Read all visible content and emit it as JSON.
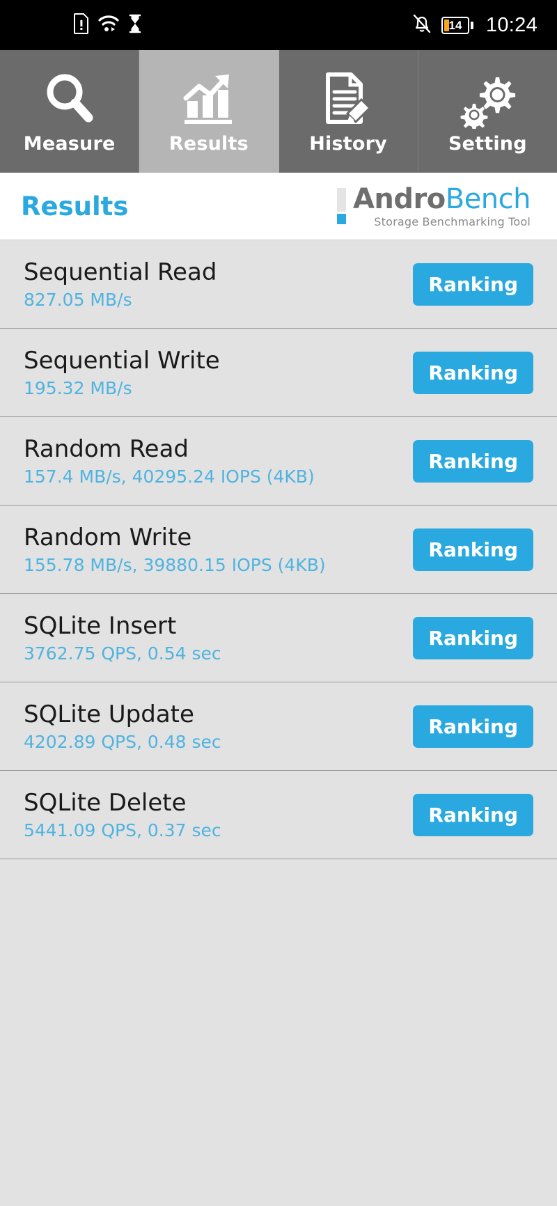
{
  "statusbar": {
    "time": "10:24",
    "battery_percent": "14",
    "icons_left": [
      "sim-alert-icon",
      "wifi-icon",
      "hourglass-icon"
    ],
    "icons_right": [
      "mute-bell-icon",
      "battery-icon"
    ]
  },
  "tabs": [
    {
      "label": "Measure",
      "icon": "search-icon",
      "active": false
    },
    {
      "label": "Results",
      "icon": "bar-chart-icon",
      "active": true
    },
    {
      "label": "History",
      "icon": "document-edit-icon",
      "active": false
    },
    {
      "label": "Setting",
      "icon": "gears-icon",
      "active": false
    }
  ],
  "header": {
    "title": "Results",
    "logo_primary": "Andro",
    "logo_secondary": "Bench",
    "logo_tagline": "Storage Benchmarking Tool"
  },
  "colors": {
    "accent_blue": "#29a9e0",
    "value_blue": "#4fb3e0",
    "tab_bg": "#6b6b6b",
    "tab_active_bg": "#b5b5b5",
    "list_bg": "#e2e2e2",
    "battery_orange": "#f5a623"
  },
  "results": {
    "button_label": "Ranking",
    "rows": [
      {
        "title": "Sequential Read",
        "value": "827.05 MB/s"
      },
      {
        "title": "Sequential Write",
        "value": "195.32 MB/s"
      },
      {
        "title": "Random Read",
        "value": "157.4 MB/s, 40295.24 IOPS (4KB)"
      },
      {
        "title": "Random Write",
        "value": "155.78 MB/s, 39880.15 IOPS (4KB)"
      },
      {
        "title": "SQLite Insert",
        "value": "3762.75 QPS, 0.54 sec"
      },
      {
        "title": "SQLite Update",
        "value": "4202.89 QPS, 0.48 sec"
      },
      {
        "title": "SQLite Delete",
        "value": "5441.09 QPS, 0.37 sec"
      }
    ]
  }
}
